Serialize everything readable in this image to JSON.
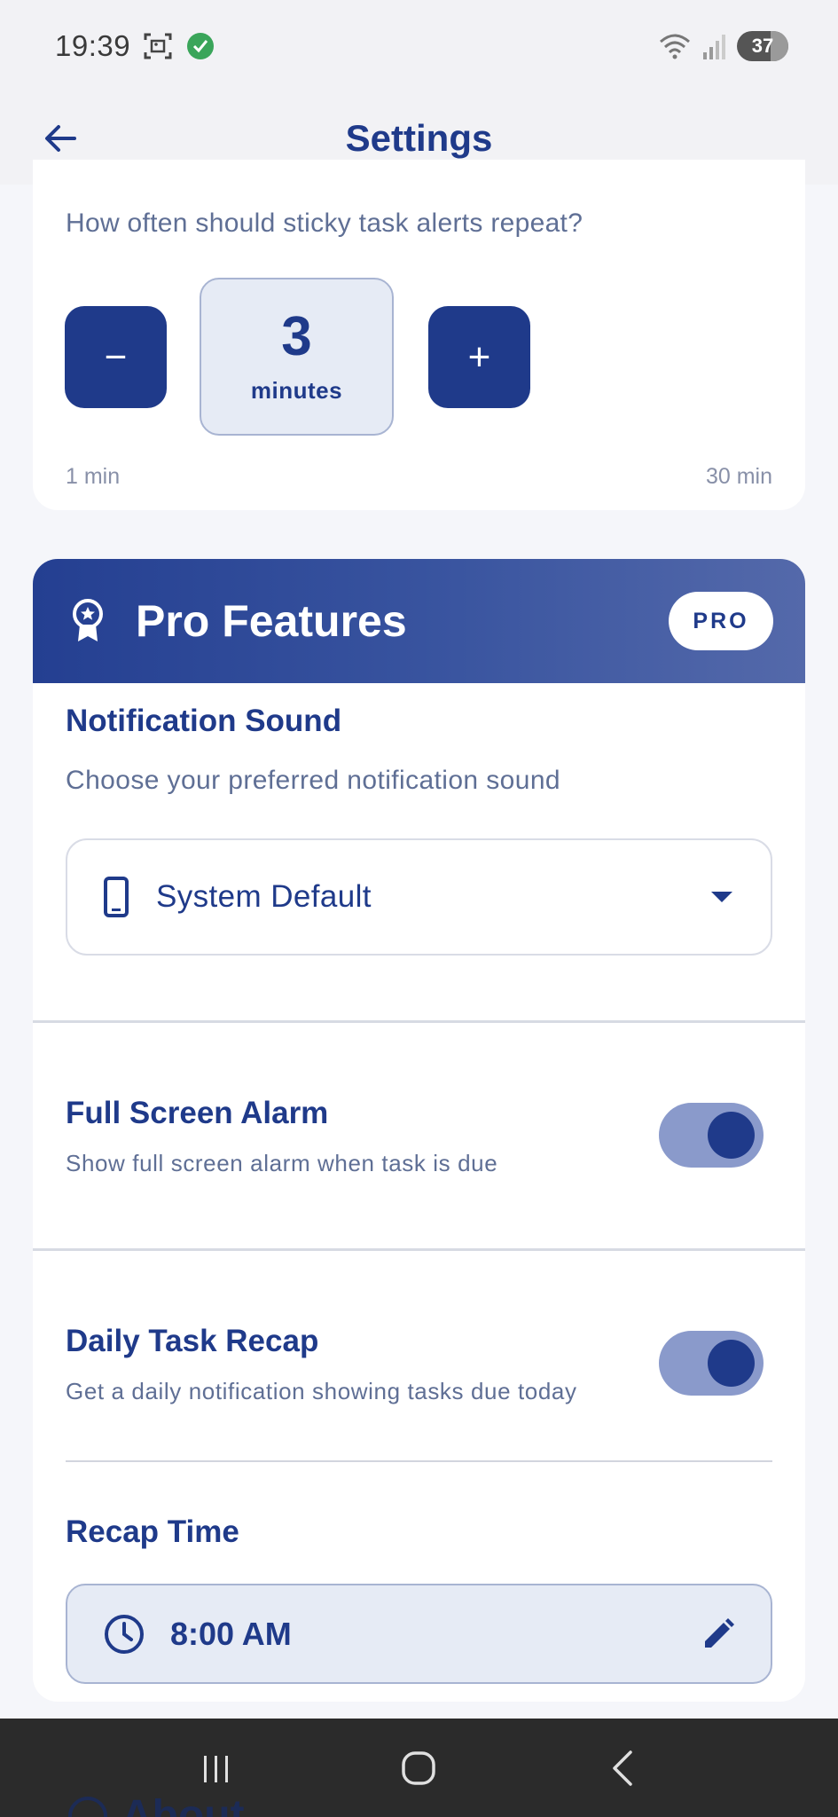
{
  "status_bar": {
    "time": "19:39",
    "battery": "37"
  },
  "app_bar": {
    "title": "Settings"
  },
  "repeat_interval": {
    "question": "How often should sticky task alerts repeat?",
    "value": "3",
    "unit": "minutes",
    "minus_label": "−",
    "plus_label": "+",
    "range_min": "1 min",
    "range_max": "30 min"
  },
  "pro": {
    "title": "Pro Features",
    "badge": "PRO",
    "notification_sound": {
      "title": "Notification Sound",
      "description": "Choose your preferred notification sound",
      "selected": "System Default"
    },
    "full_screen_alarm": {
      "title": "Full Screen Alarm",
      "description": "Show full screen alarm when task is due",
      "enabled": true
    },
    "daily_recap": {
      "title": "Daily Task Recap",
      "description": "Get a daily notification showing tasks due today",
      "enabled": true
    },
    "recap_time": {
      "title": "Recap Time",
      "value": "8:00 AM"
    }
  },
  "peek": {
    "label": "About"
  },
  "colors": {
    "primary": "#1f3a8a",
    "toggle_track": "#8a9acb",
    "field_bg": "#e6ebf5"
  }
}
